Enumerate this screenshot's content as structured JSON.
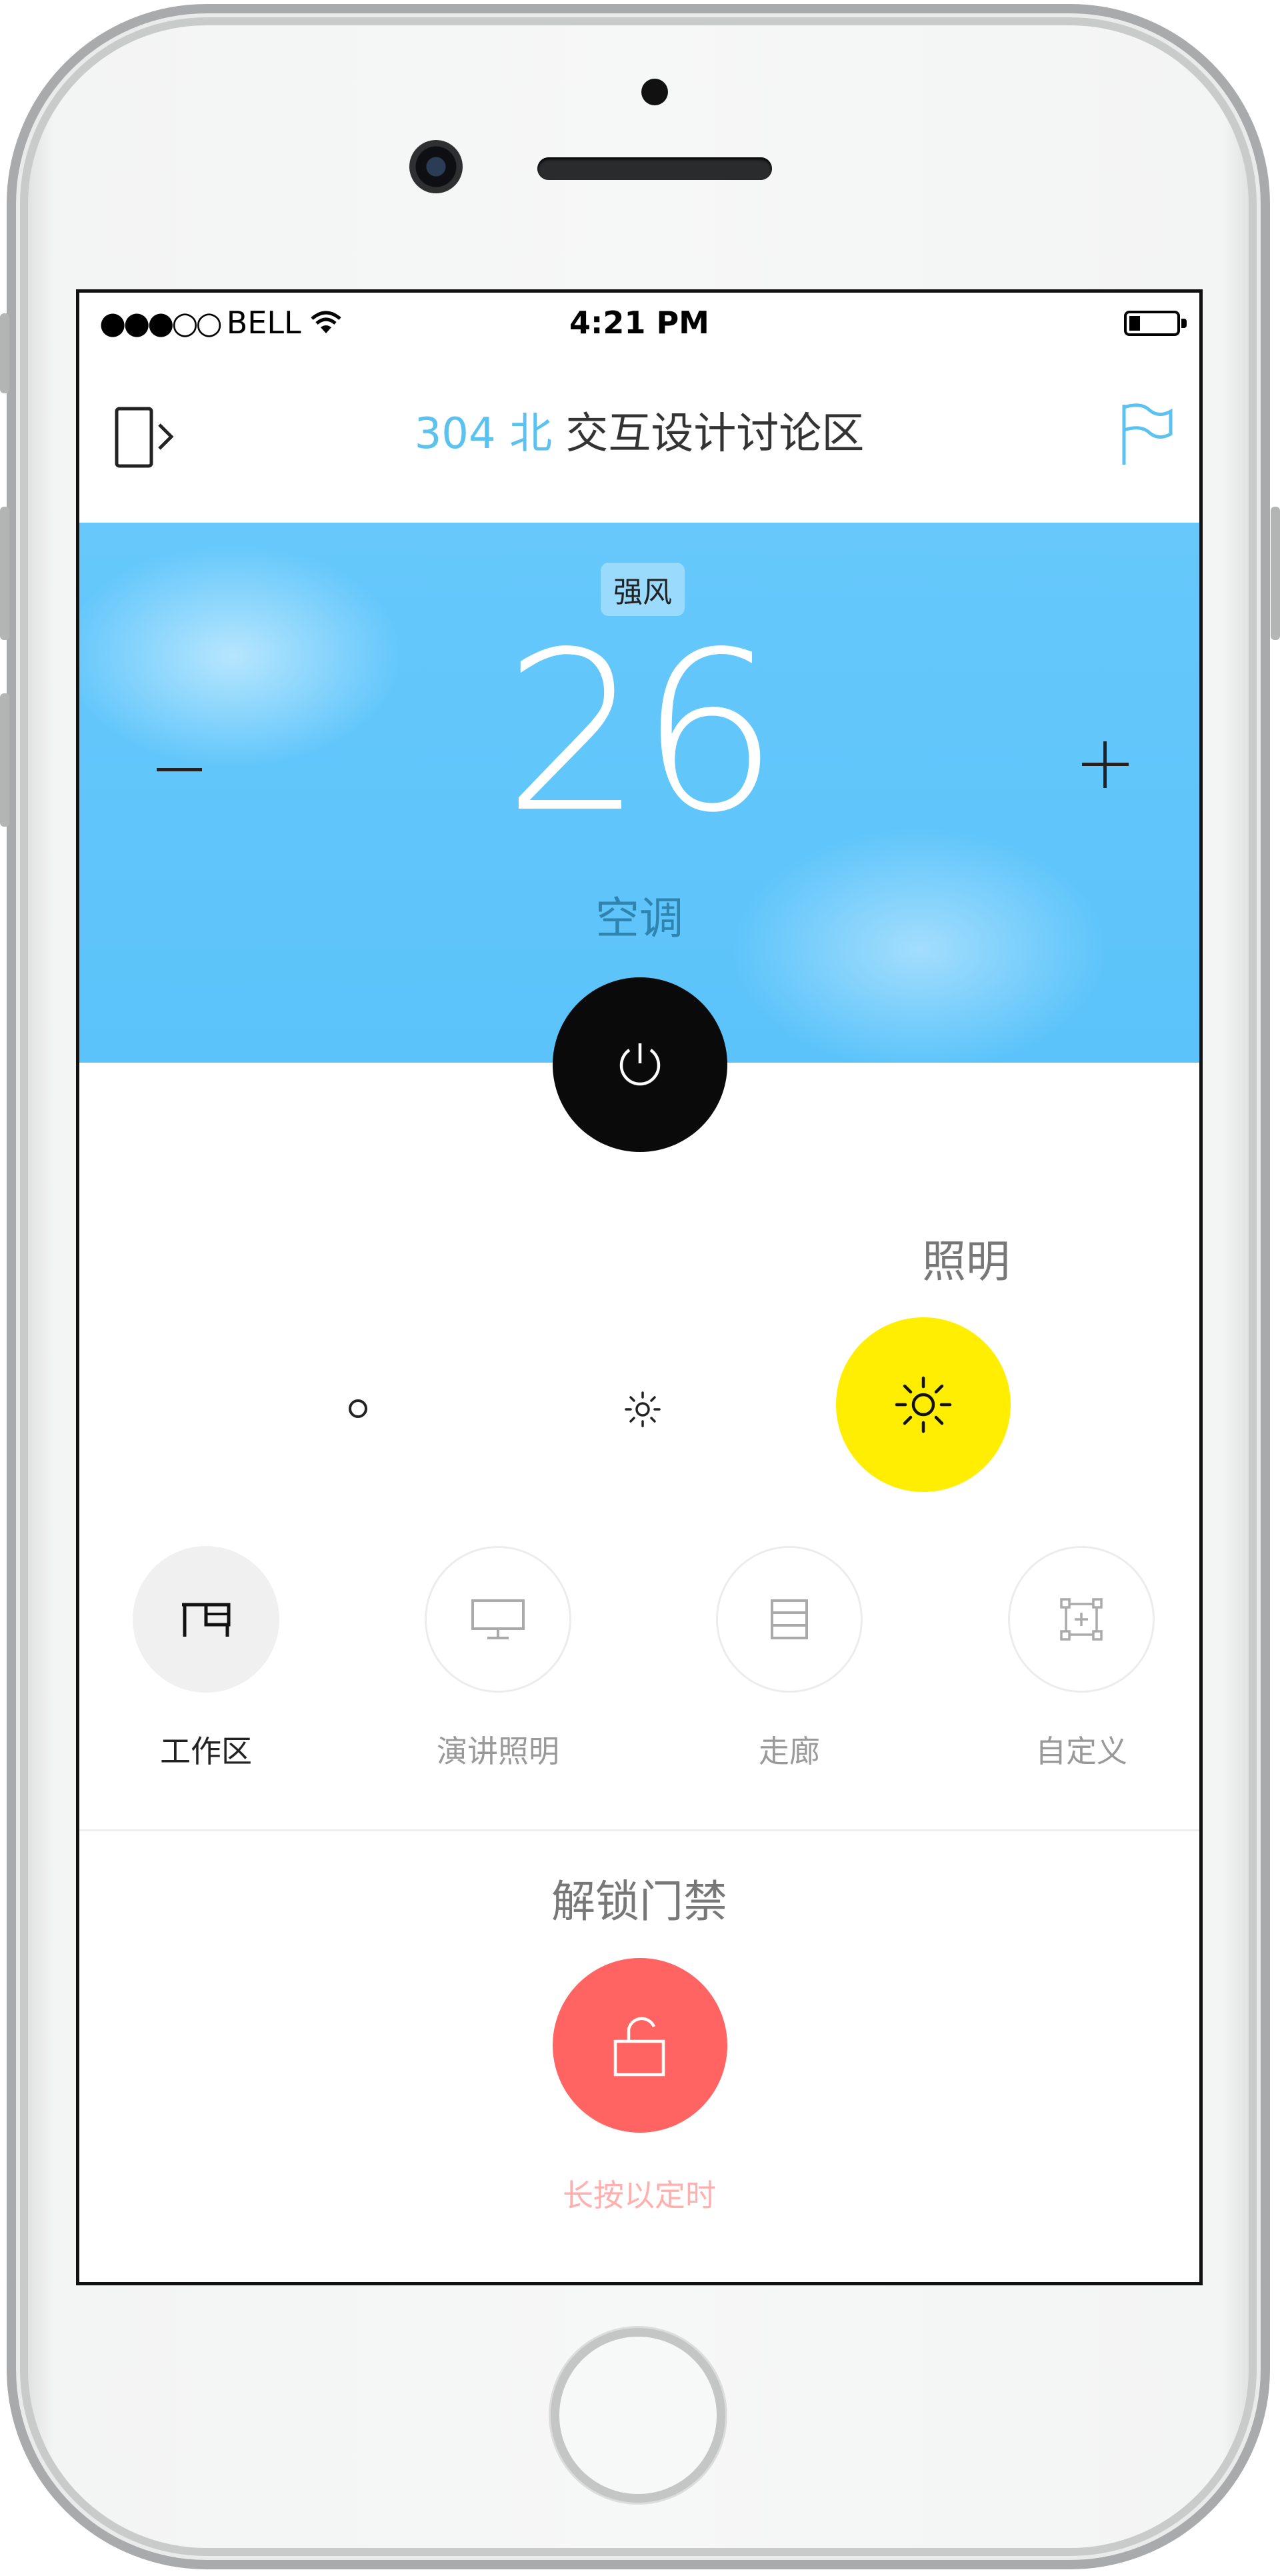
{
  "status_bar": {
    "signal": "●●●○○",
    "carrier": "BELL",
    "time": "4:21 PM"
  },
  "nav": {
    "room": "304 北",
    "area": "交互设计讨论区",
    "exit_icon": "door-exit-icon",
    "flag_icon": "flag-icon"
  },
  "ac": {
    "mode": "强风",
    "temperature": "26",
    "label": "空调"
  },
  "lighting": {
    "title": "照明",
    "brightness_levels": 3,
    "active_level": 3
  },
  "scenes": [
    {
      "label": "工作区",
      "icon": "desk-icon",
      "active": true
    },
    {
      "label": "演讲照明",
      "icon": "monitor-icon",
      "active": false
    },
    {
      "label": "走廊",
      "icon": "corridor-icon",
      "active": false
    },
    {
      "label": "自定义",
      "icon": "custom-add-icon",
      "active": false
    }
  ],
  "door": {
    "title": "解锁门禁",
    "hint": "长按以定时"
  },
  "colors": {
    "accent_blue": "#5bc2f0",
    "ac_panel": "#5bc3fa",
    "light_on": "#ffee00",
    "unlock_red": "#ff6463"
  }
}
